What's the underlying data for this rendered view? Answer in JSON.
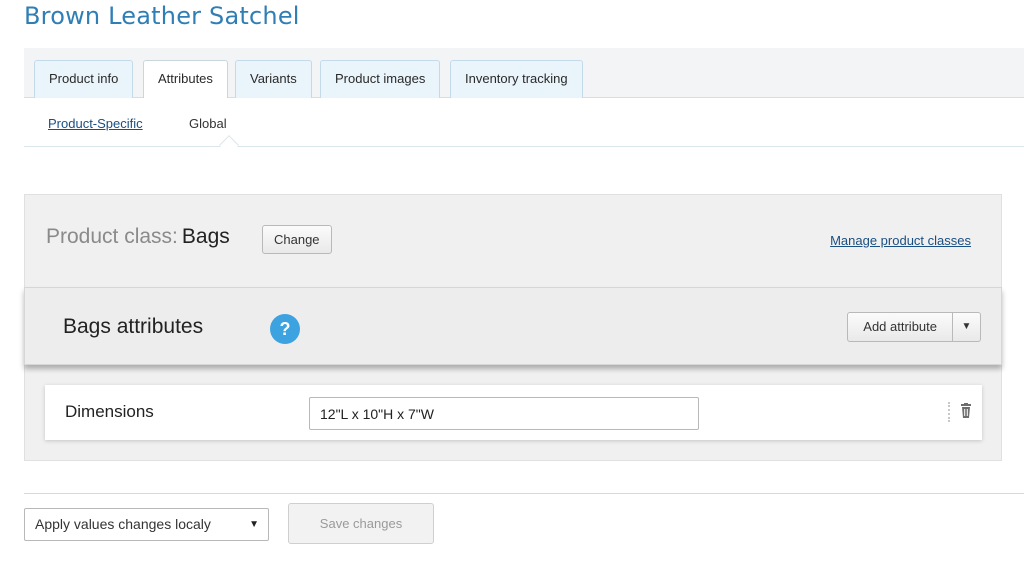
{
  "product": {
    "title": "Brown Leather Satchel"
  },
  "tabs": [
    {
      "label": "Product info"
    },
    {
      "label": "Attributes"
    },
    {
      "label": "Variants"
    },
    {
      "label": "Product images"
    },
    {
      "label": "Inventory tracking"
    }
  ],
  "active_tab": "Attributes",
  "subtabs": [
    {
      "label": "Product-Specific"
    },
    {
      "label": "Global"
    }
  ],
  "active_subtab": "Global",
  "product_class": {
    "label": "Product class:",
    "value": "Bags",
    "change_label": "Change",
    "manage_link": "Manage product classes"
  },
  "attributes_panel": {
    "title": "Bags attributes",
    "help_icon": "question-mark-icon",
    "add_label": "Add attribute",
    "add_caret_icon": "caret-down-icon"
  },
  "attributes": [
    {
      "name": "Dimensions",
      "value": "12\"L x 10\"H x 7\"W"
    }
  ],
  "footer": {
    "apply_select_value": "Apply values changes localy",
    "save_label": "Save changes"
  },
  "colors": {
    "title_blue": "#2f7fb5",
    "link": "#1b4f82",
    "help_icon": "#3da3e0"
  }
}
